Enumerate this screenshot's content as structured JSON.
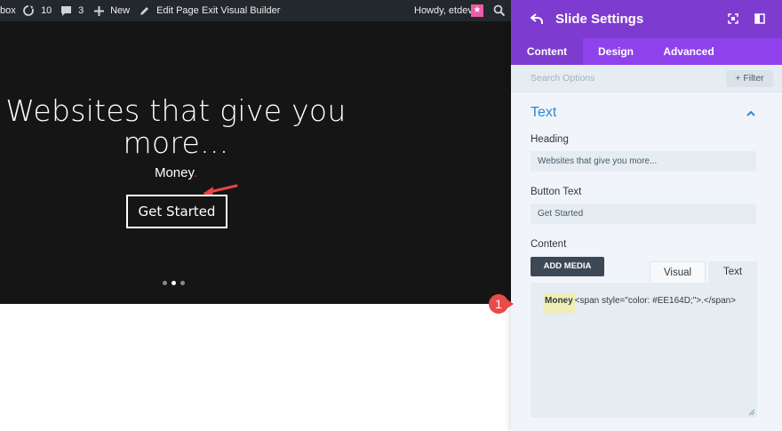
{
  "admin_bar": {
    "site_fragment": "box",
    "updates_count": "10",
    "comments_count": "3",
    "new_label": "New",
    "edit_page_label": "Edit Page",
    "exit_label": "Exit Visual Builder",
    "howdy_label": "Howdy, etdev",
    "avatar_glyph": "★",
    "icons": [
      "refresh-icon",
      "comment-icon",
      "plus-icon",
      "pencil-icon",
      "search-icon"
    ]
  },
  "slide": {
    "heading_line1": "Websites that give you",
    "heading_line2": "more...",
    "content_word": "Money",
    "content_punct": ".",
    "button_label": "Get Started",
    "pager_dots": 3,
    "active_dot": 2
  },
  "panel": {
    "title": "Slide Settings",
    "tabs": [
      {
        "label": "Content",
        "active": true
      },
      {
        "label": "Design",
        "active": false
      },
      {
        "label": "Advanced",
        "active": false
      }
    ],
    "search_placeholder": "Search Options",
    "filter_label": "+ Filter",
    "section_title": "Text",
    "heading_label": "Heading",
    "heading_value": "Websites that give you more...",
    "button_text_label": "Button Text",
    "button_text_value": "Get Started",
    "content_label": "Content",
    "add_media_label": "ADD MEDIA",
    "visual_tab": "Visual",
    "text_tab": "Text",
    "editor_word": "Money",
    "editor_rest": "<span style=\"color: #EE164D;\">.</span>"
  },
  "annotation": {
    "step_number": "1"
  },
  "colors": {
    "panel_header": "#7e3bd0",
    "panel_tabs": "#8f42ec",
    "accent_blue": "#2b87da",
    "period_color": "#EE164D",
    "badge_red": "#e94a4a",
    "admin_bar": "#23282d",
    "slider_bg": "#151515"
  }
}
